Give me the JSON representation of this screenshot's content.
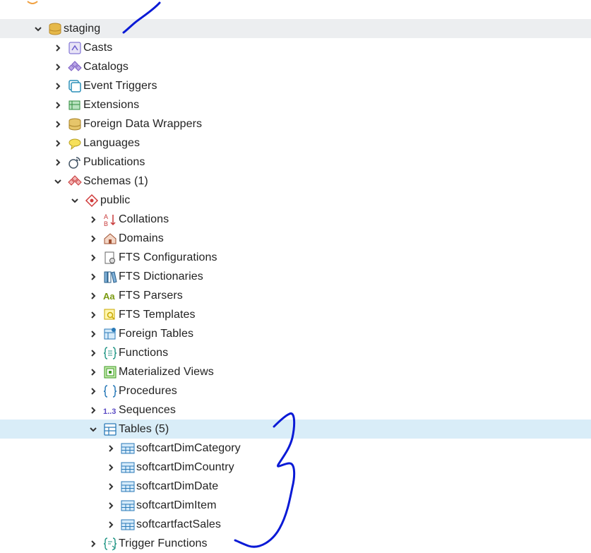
{
  "tree": {
    "database": {
      "label": "staging",
      "icon": "database-icon"
    },
    "db_children": [
      {
        "label": "Casts",
        "icon": "casts-icon"
      },
      {
        "label": "Catalogs",
        "icon": "catalogs-icon"
      },
      {
        "label": "Event Triggers",
        "icon": "event-triggers-icon"
      },
      {
        "label": "Extensions",
        "icon": "extensions-icon"
      },
      {
        "label": "Foreign Data Wrappers",
        "icon": "foreign-data-wrappers-icon"
      },
      {
        "label": "Languages",
        "icon": "languages-icon"
      },
      {
        "label": "Publications",
        "icon": "publications-icon"
      },
      {
        "label": "Schemas (1)",
        "icon": "schemas-icon"
      }
    ],
    "schema": {
      "label": "public",
      "icon": "schema-icon"
    },
    "schema_children": [
      {
        "label": "Collations",
        "icon": "collations-icon"
      },
      {
        "label": "Domains",
        "icon": "domains-icon"
      },
      {
        "label": "FTS Configurations",
        "icon": "fts-configurations-icon"
      },
      {
        "label": "FTS Dictionaries",
        "icon": "fts-dictionaries-icon"
      },
      {
        "label": "FTS Parsers",
        "icon": "fts-parsers-icon"
      },
      {
        "label": "FTS Templates",
        "icon": "fts-templates-icon"
      },
      {
        "label": "Foreign Tables",
        "icon": "foreign-tables-icon"
      },
      {
        "label": "Functions",
        "icon": "functions-icon"
      },
      {
        "label": "Materialized Views",
        "icon": "materialized-views-icon"
      },
      {
        "label": "Procedures",
        "icon": "procedures-icon"
      },
      {
        "label": "Sequences",
        "icon": "sequences-icon"
      },
      {
        "label": "Tables (5)",
        "icon": "tables-icon"
      }
    ],
    "tables": [
      {
        "label": "softcartDimCategory",
        "icon": "table-icon"
      },
      {
        "label": "softcartDimCountry",
        "icon": "table-icon"
      },
      {
        "label": "softcartDimDate",
        "icon": "table-icon"
      },
      {
        "label": "softcartDimItem",
        "icon": "table-icon"
      },
      {
        "label": "softcartfactSales",
        "icon": "table-icon"
      }
    ],
    "after_tables": {
      "label": "Trigger Functions",
      "icon": "trigger-functions-icon"
    }
  },
  "colors": {
    "selected_row": "#eceef0",
    "highlighted_row": "#d9edf8",
    "annotation_ink": "#0a1ad6"
  }
}
